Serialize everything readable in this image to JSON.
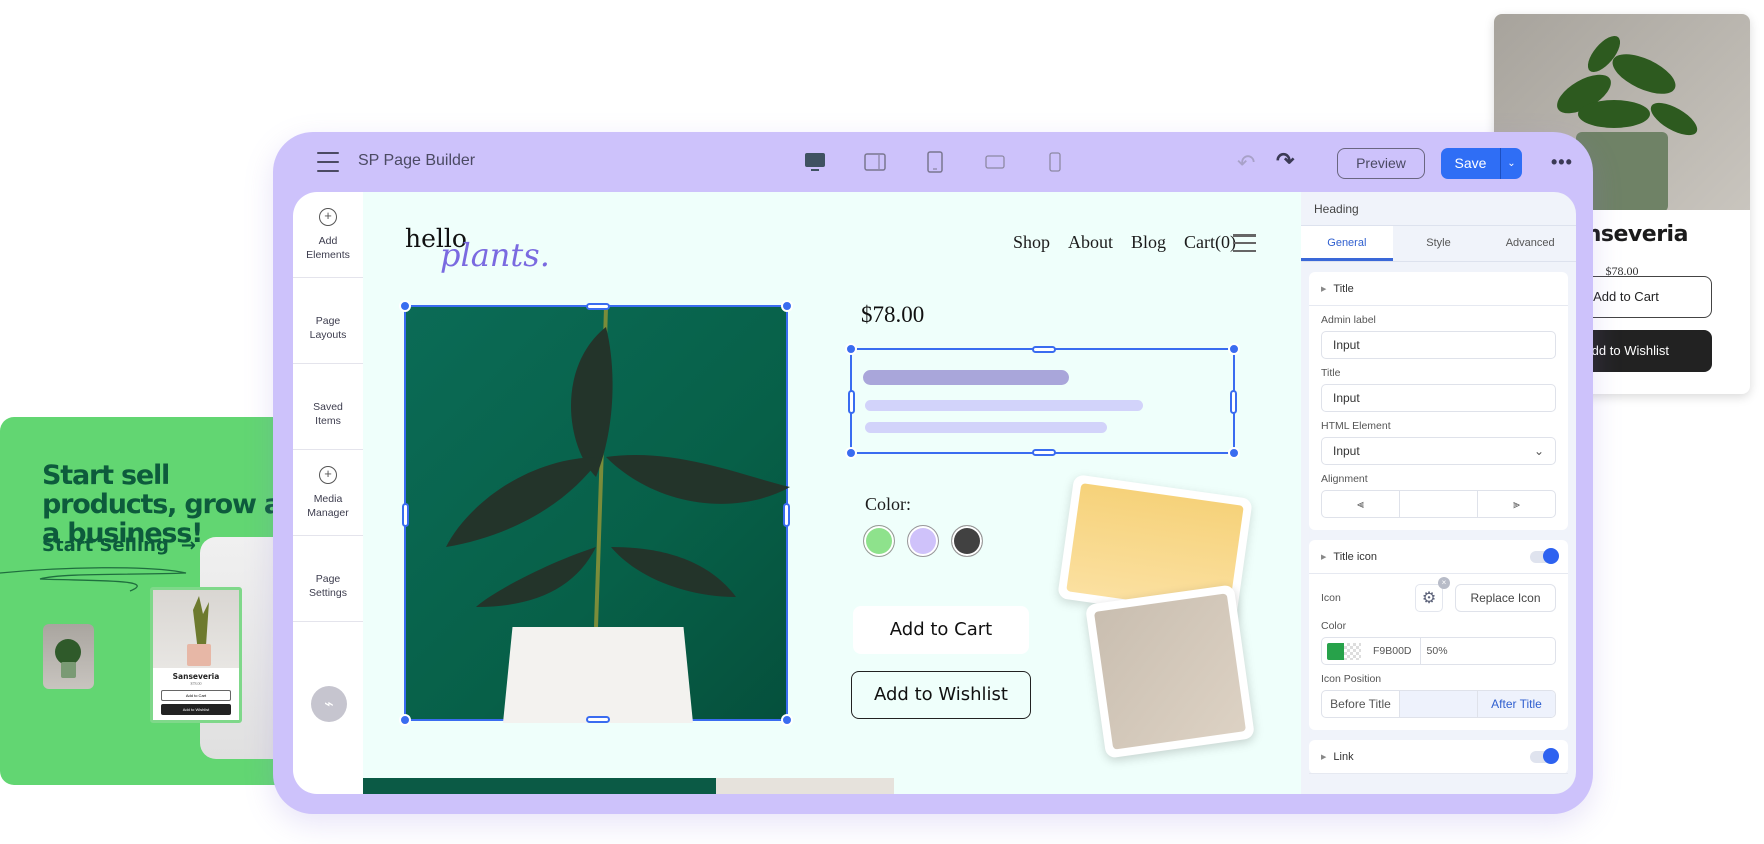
{
  "promo": {
    "headline": "Start sell products, grow as a business!",
    "cta": "Start Selling",
    "cta_icon": "arrow-right-icon",
    "mini_card": {
      "name": "Sanseveria",
      "price": "$78.00",
      "add_to_cart": "Add to Cart",
      "add_to_wishlist": "Add to Wishlist"
    }
  },
  "product_card": {
    "name": "Sanseveria",
    "price": "$78.00",
    "add_to_cart": "Add to Cart",
    "add_to_wishlist": "Add to Wishlist"
  },
  "app": {
    "title": "SP Page Builder",
    "devices": [
      "desktop",
      "tablet-landscape",
      "tablet",
      "mobile-landscape",
      "mobile"
    ],
    "preview_label": "Preview",
    "save_label": "Save",
    "undo_icon": "↶",
    "redo_icon": "↷",
    "more_icon": "•••"
  },
  "sidebar": {
    "items": [
      {
        "label": "Add Elements",
        "icon": "+"
      },
      {
        "label": "Page Layouts"
      },
      {
        "label": "Saved Items"
      },
      {
        "label": "Media Manager",
        "icon": "+"
      },
      {
        "label": "Page Settings"
      }
    ]
  },
  "site": {
    "logo_hello": "hello",
    "logo_plants": "plants.",
    "nav": [
      "Shop",
      "About",
      "Blog",
      "Cart(0)"
    ],
    "price": "$78.00",
    "color_label": "Color:",
    "swatches": [
      "#8ee28c",
      "#cfc2fa",
      "#414141"
    ],
    "add_to_cart": "Add to Cart",
    "add_to_wishlist": "Add to Wishlist"
  },
  "inspector": {
    "heading": "Heading",
    "tabs": [
      "General",
      "Style",
      "Advanced"
    ],
    "active_tab": "General",
    "title_section": "Title",
    "admin_label": {
      "label": "Admin label",
      "value": "Input"
    },
    "title_field": {
      "label": "Title",
      "value": "Input"
    },
    "html_element": {
      "label": "HTML Element",
      "value": "Input"
    },
    "alignment_label": "Alignment",
    "title_icon_section": "Title icon",
    "title_icon_enabled": true,
    "icon_label": "Icon",
    "replace_icon": "Replace Icon",
    "color_label": "Color",
    "color_hex": "F9B00D",
    "color_opacity": "50%",
    "icon_position_label": "Icon Position",
    "icon_position_options": [
      "Before Title",
      "",
      "After Title"
    ],
    "icon_position_selected": "After Title",
    "link_section": "Link",
    "link_enabled": true
  },
  "colors": {
    "frame": "#cdc2fb",
    "accent": "#2f6ef5",
    "promo_bg": "#62d672",
    "promo_text": "#0d5b3c"
  }
}
